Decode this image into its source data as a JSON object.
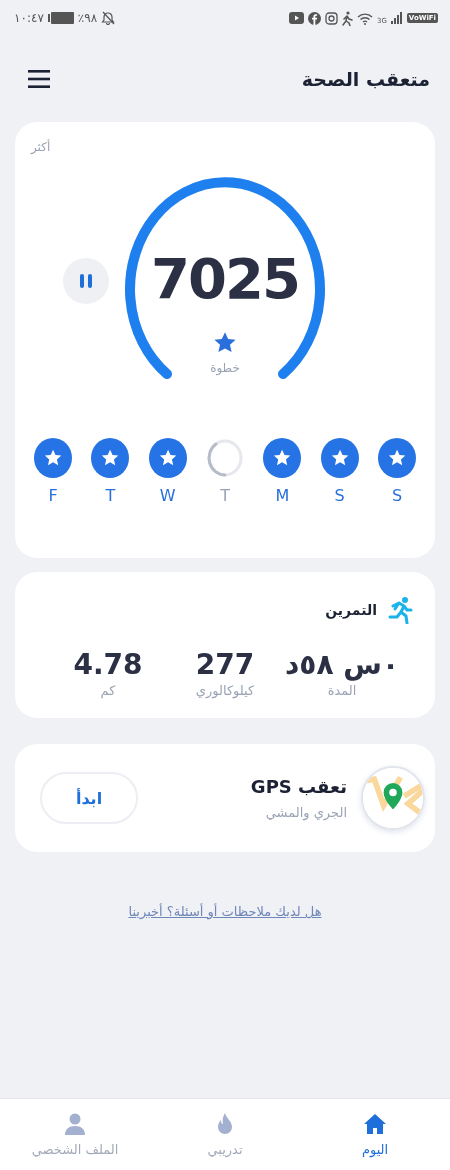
{
  "status_bar": {
    "time": "١٠:٤٧",
    "battery": "٪٩٨",
    "network": "3G",
    "badge": "VoWiFi"
  },
  "header": {
    "title": "متعقب الصحة"
  },
  "steps": {
    "more": "أكثر",
    "value": "7025",
    "unit": "خطوة",
    "days": [
      {
        "label": "S",
        "done": true
      },
      {
        "label": "S",
        "done": true
      },
      {
        "label": "M",
        "done": true
      },
      {
        "label": "T",
        "done": false
      },
      {
        "label": "W",
        "done": true
      },
      {
        "label": "T",
        "done": true
      },
      {
        "label": "F",
        "done": true
      }
    ]
  },
  "workout": {
    "title": "التمرين",
    "stats": [
      {
        "value": "٠س ٥٨د",
        "label": "المدة"
      },
      {
        "value": "277",
        "label": "كيلوكالوري"
      },
      {
        "value": "4.78",
        "label": "كم"
      }
    ]
  },
  "gps": {
    "title": "تعقب GPS",
    "subtitle": "الجري والمشي",
    "button": "ابدأ"
  },
  "feedback_link": "هل لديك ملاحظات أو أسئلة؟ أخبرينا",
  "nav": [
    {
      "label": "اليوم",
      "kind": "home",
      "selected": true
    },
    {
      "label": "تدريبي",
      "kind": "flame",
      "selected": false
    },
    {
      "label": "الملف الشخصي",
      "kind": "person",
      "selected": false
    }
  ]
}
